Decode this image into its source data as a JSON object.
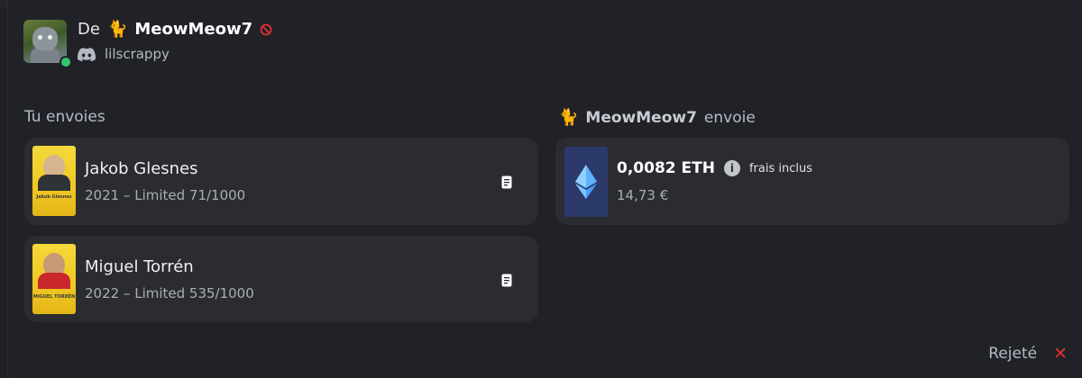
{
  "header": {
    "from_prefix": "De",
    "sender_emoji": "🐈",
    "sender_name": "MeowMeow7",
    "discord_username": "lilscrappy"
  },
  "you_send": {
    "label": "Tu envoies",
    "items": [
      {
        "name": "Jakob Glesnes",
        "detail": "2021 – Limited 71/1000",
        "card_text": "Jakob Glesnes"
      },
      {
        "name": "Miguel Torrén",
        "detail": "2022 – Limited 535/1000",
        "card_text": "MIGUEL TORRÉN"
      }
    ]
  },
  "they_send": {
    "emoji": "🐈",
    "name": "MeowMeow7",
    "verb": "envoie",
    "amount": "0,0082 ETH",
    "fees_note": "frais inclus",
    "fiat": "14,73 €"
  },
  "footer": {
    "status": "Rejeté",
    "close_symbol": "✕"
  },
  "colors": {
    "background": "#202228",
    "card": "#2b2c31",
    "online": "#2ec86b",
    "rejected": "#e03131",
    "eth_box": "#2c3a6b"
  }
}
